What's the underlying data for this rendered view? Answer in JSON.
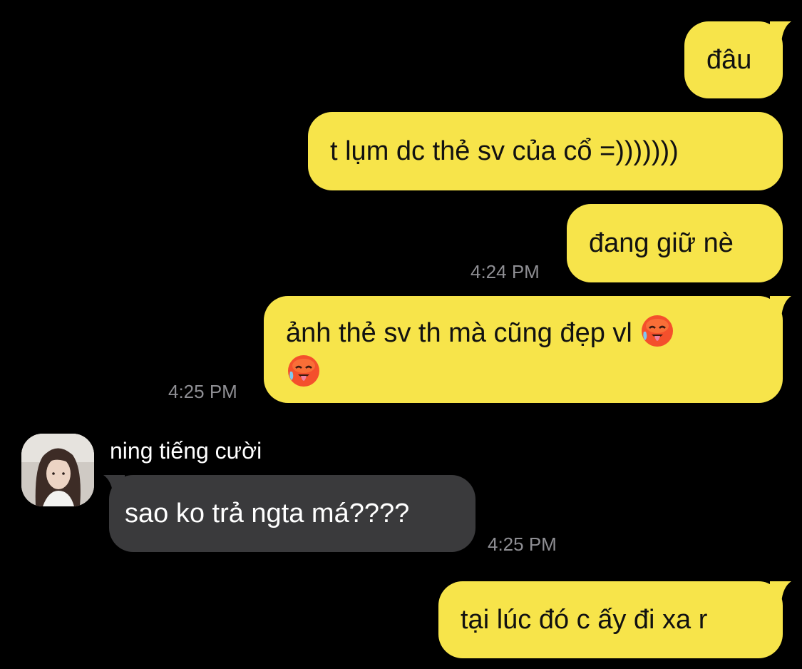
{
  "conversation": {
    "messages": [
      {
        "from": "me",
        "text": "đâu"
      },
      {
        "from": "me",
        "text": "t lụm dc thẻ sv của cổ =)))))))"
      },
      {
        "from": "me",
        "text": "đang giữ nè",
        "time": "4:24 PM"
      },
      {
        "from": "me",
        "text_line1": "ảnh thẻ sv th mà cũng đẹp vl",
        "emoji": "hot-face-emoji",
        "time": "4:25 PM"
      },
      {
        "from": "other",
        "sender": "ning tiếng cười",
        "text": "sao ko trả ngta má????",
        "time": "4:25 PM"
      },
      {
        "from": "me",
        "text": "tại lúc đó c ấy đi xa r"
      }
    ]
  },
  "colors": {
    "background": "#000000",
    "outgoing_bubble": "#f7e44a",
    "incoming_bubble": "#3a3a3c",
    "timestamp": "#8e8e93"
  }
}
